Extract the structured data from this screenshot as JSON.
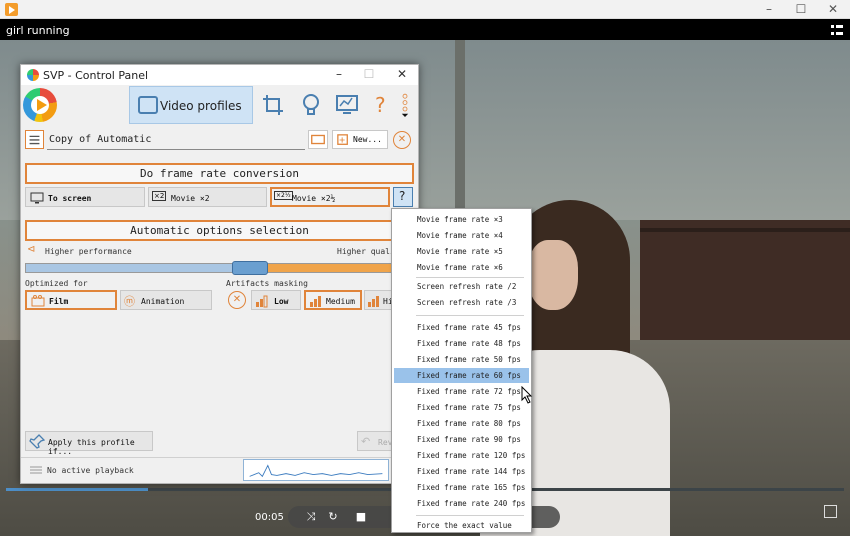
{
  "player": {
    "window_title": "",
    "video_title": "girl running",
    "time": "00:05",
    "progress_fraction": 0.17
  },
  "svp": {
    "title": "SVP - Control Panel",
    "tab_label": "Video profiles",
    "profile_name": "Copy of Automatic",
    "new_button": "New...",
    "frame_rate_button": "Do frame rate conversion",
    "to_screen": "To screen",
    "movie_x2": "Movie ×2",
    "movie_x25": "Movie ×2½",
    "auto_options": "Automatic options selection",
    "higher_performance": "Higher performance",
    "higher_quality": "Higher quality",
    "slider_fraction": 0.61,
    "optimized_for": "Optimized for",
    "film": "Film",
    "animation": "Animation",
    "artifacts_masking": "Artifacts masking",
    "low": "Low",
    "medium": "Medium",
    "high": "Hi",
    "apply_profile": "Apply this profile if...",
    "revert": "Rev",
    "no_playback": "No active playback"
  },
  "dropdown": {
    "items": [
      "Movie frame rate ×3",
      "Movie frame rate ×4",
      "Movie frame rate ×5",
      "Movie frame rate ×6",
      "Screen refresh rate /2",
      "Screen refresh rate /3",
      "Fixed frame rate 45 fps",
      "Fixed frame rate 48 fps",
      "Fixed frame rate 50 fps",
      "Fixed frame rate 60 fps",
      "Fixed frame rate 72 fps",
      "Fixed frame rate 75 fps",
      "Fixed frame rate 80 fps",
      "Fixed frame rate 90 fps",
      "Fixed frame rate 120 fps",
      "Fixed frame rate 144 fps",
      "Fixed frame rate 165 fps",
      "Fixed frame rate 240 fps",
      "Force the exact value"
    ],
    "selected": "Fixed frame rate 60 fps"
  },
  "colors": {
    "accent_orange": "#e0843a",
    "selection_blue": "#9ac2ea",
    "slider_blue": "#a9c6e3"
  }
}
